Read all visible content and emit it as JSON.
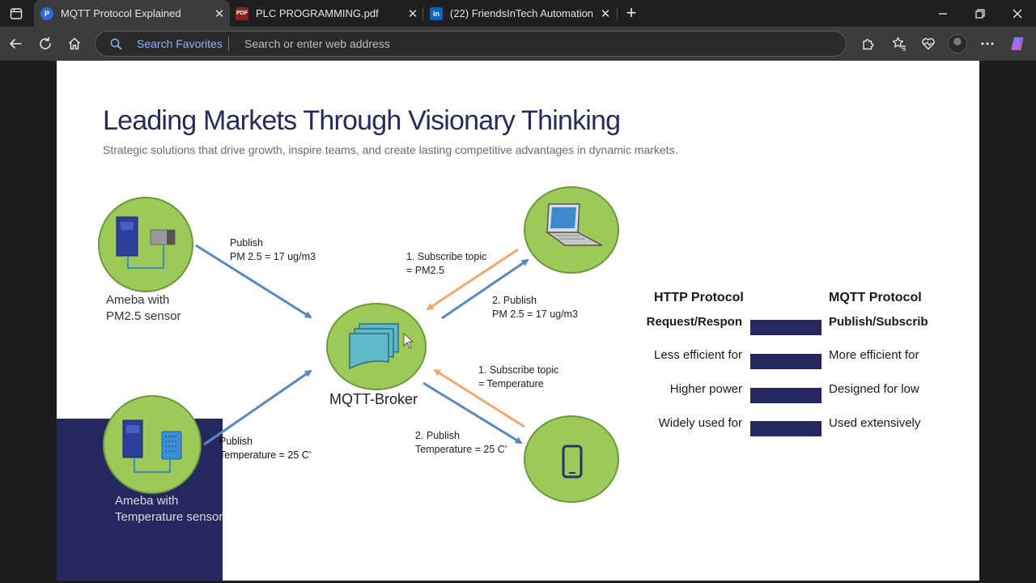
{
  "browser": {
    "tabs": [
      {
        "title": "MQTT Protocol Explained",
        "icon": "perplexity-icon",
        "active": true
      },
      {
        "title": "PLC PROGRAMMING.pdf",
        "icon": "pdf-icon",
        "active": false
      },
      {
        "title": "(22) FriendsInTech Automation | L",
        "icon": "linkedin-icon",
        "active": false
      }
    ],
    "new_tab_symbol": "+",
    "search_favorites_label": "Search Favorites",
    "address_placeholder": "Search or enter web address"
  },
  "slide": {
    "title": "Leading Markets Through Visionary Thinking",
    "subtitle": "Strategic solutions that drive growth, inspire teams, and create lasting competitive advantages in dynamic markets."
  },
  "diagram": {
    "device_pm25": [
      "Ameba with",
      "PM2.5 sensor"
    ],
    "device_temp": [
      "Ameba with",
      "Temperature sensor"
    ],
    "broker_label": "MQTT-Broker",
    "publish_pm25": [
      "Publish",
      "PM 2.5 = 17 ug/m3"
    ],
    "publish_temp": [
      "Publish",
      "Temperature = 25 C'"
    ],
    "subscribe_pm25": [
      "1. Subscribe topic",
      "= PM2.5"
    ],
    "forward_pm25": [
      "2. Publish",
      "PM 2.5 = 17 ug/m3"
    ],
    "subscribe_temp": [
      "1. Subscribe topic",
      "= Temperature"
    ],
    "forward_temp": [
      "2. Publish",
      "Temperature = 25 C'"
    ]
  },
  "comparison": {
    "headers": {
      "left": "HTTP Protocol",
      "right": "MQTT Protocol"
    },
    "rows": [
      {
        "left": "Request/Respon",
        "right": "Publish/Subscrib"
      },
      {
        "left": "Less efficient for",
        "right": "More efficient for"
      },
      {
        "left": "Higher power",
        "right": "Designed for low"
      },
      {
        "left": "Widely used for",
        "right": "Used extensively"
      }
    ]
  },
  "colors": {
    "navy": "#25275e",
    "circle_fill": "#9dc95a",
    "circle_stroke": "#6a9a3a",
    "arrow_blue": "#5b87bd",
    "arrow_orange": "#f0a86c"
  }
}
